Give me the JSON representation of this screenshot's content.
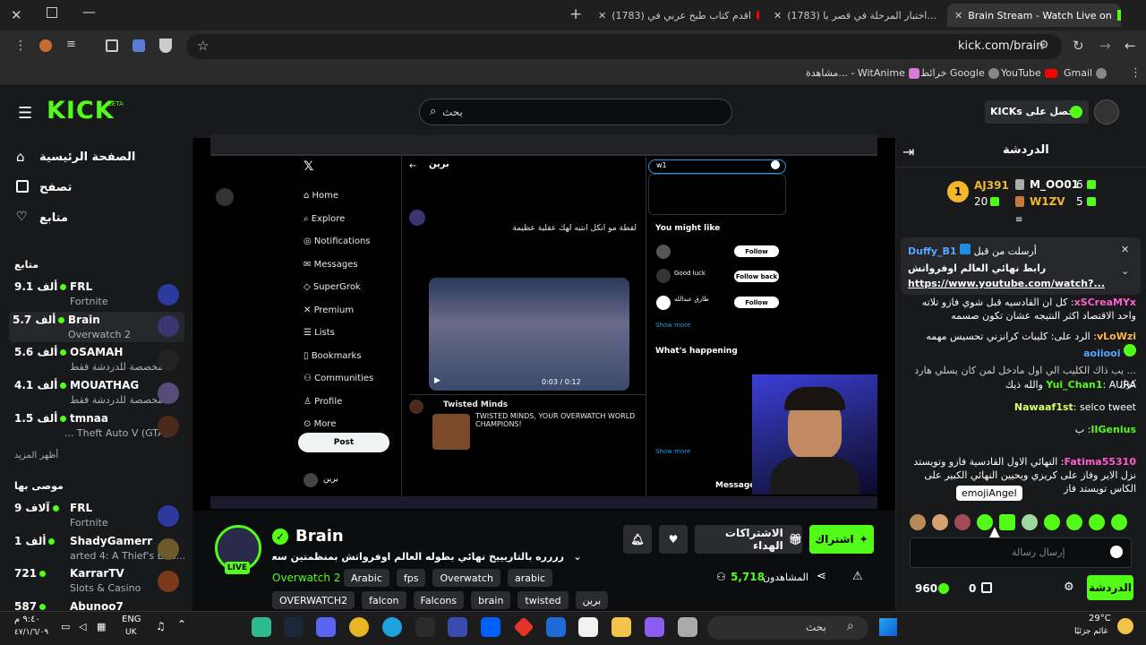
{
  "browser": {
    "tabs": [
      {
        "label": "Brain Stream - Watch Live on"
      },
      {
        "label": "(1783) اختبار المرحلة في قصر يا..."
      },
      {
        "label": "(1783) اقدم كتاب طبخ عربي في"
      }
    ],
    "url": "kick.com/brain",
    "bookmarks": [
      "Gmail",
      "YouTube",
      "خرائط Google",
      "مشاهدة... - WitAnime"
    ]
  },
  "header": {
    "logo": "KICK",
    "logo_badge": "BETA",
    "search_placeholder": "بحث",
    "get_kicks": "احصل على KICKs"
  },
  "sidebar": {
    "nav": [
      {
        "label": "الصفحة الرئيسية",
        "icon": "home-icon"
      },
      {
        "label": "تصفح",
        "icon": "browse-icon"
      },
      {
        "label": "متابع",
        "icon": "heart-icon"
      }
    ],
    "following_title": "متابع",
    "following": [
      {
        "name": "FRL",
        "viewers": "9.1 ألف",
        "category": "Fortnite"
      },
      {
        "name": "Brain",
        "viewers": "5.7 ألف",
        "category": "Overwatch 2"
      },
      {
        "name": "OSAMAH",
        "viewers": "5.6 ألف",
        "category": "مخصصة للدردشة فقط"
      },
      {
        "name": "MOUATHAG",
        "viewers": "4.1 ألف",
        "category": "مخصصة للدردشة فقط"
      },
      {
        "name": "tmnaa",
        "viewers": "1.5 ألف",
        "category": "Theft Auto V (GTA) ..."
      }
    ],
    "show_more": "أظهر المزيد",
    "recommended_title": "موصى بها",
    "recommended": [
      {
        "name": "FRL",
        "viewers": "9 آلاف",
        "category": "Fortnite"
      },
      {
        "name": "ShadyGamerr",
        "viewers": "1 ألف",
        "category": "arted 4: A Thief's End..."
      },
      {
        "name": "KarrarTV",
        "viewers": "721",
        "category": "Slots & Casino"
      },
      {
        "name": "Abunoo7",
        "viewers": "587",
        "category": ""
      }
    ]
  },
  "video": {
    "twitter": {
      "nav": [
        "Home",
        "Explore",
        "Notifications",
        "Messages",
        "SuperGrok",
        "Premium",
        "Lists",
        "Bookmarks",
        "Communities",
        "Profile",
        "More"
      ],
      "post_button": "Post",
      "profile_name": "برين",
      "tweet1": "لقطة مو انكل انتبه لهك عقلية عظيمة",
      "video_time": "0:03 / 0:12",
      "tweet2_name": "Twisted Minds",
      "tweet2_text": "TWISTED MINDS, YOUR OVERWATCH WORLD CHAMPIONS!",
      "search_value": "w1",
      "you_might_like": "You might like",
      "follow": "Follow",
      "follow_back": "Follow back",
      "suggest1": "Good luck",
      "suggest2": "طارق عبدالله",
      "show_more": "Show more",
      "whats_happening": "What's happening",
      "messages": "Messages"
    }
  },
  "stream": {
    "channel": "Brain",
    "live": "LIVE",
    "title": "رررره بالتاريييخ نهائي بطوله العالم اوفرواتش بمنظمتين سعودية , المحححححق...",
    "category": "Overwatch 2",
    "tags_row1": [
      "Arabic",
      "fps",
      "Overwatch",
      "arabic"
    ],
    "tags_row2": [
      "OVERWATCH2",
      "falcon",
      "Falcons",
      "brain",
      "twisted",
      "برين"
    ],
    "viewers": "5,718",
    "viewers_label": "المشاهدون",
    "subscribe": "اشتراك",
    "gift_subs": "الاشتراكات الهداء"
  },
  "chat": {
    "title": "الدردشة",
    "leaderboard": [
      {
        "name": "AJ391",
        "value": "20"
      },
      {
        "name": "M_OO01",
        "value": "6"
      },
      {
        "name": "W1ZV",
        "value": "5"
      }
    ],
    "pinned_by": "أرسلت من قبل",
    "pinned_user": "Duffy_B1",
    "pinned_text": "رابط نهائي العالم اوفرواتش",
    "pinned_link": "https://www.youtube.com/watch?...",
    "messages": [
      {
        "user": "xSCreaMYx",
        "text": "كل ان القادسيه قبل شوي فازو تلاته واحد الاقتصاد اكثر النتيجه عشان تكون صسمه"
      },
      {
        "user": "vLoWzi",
        "text": "الرد على: كليبات كرانزني تحسيس مهمه"
      },
      {
        "user": "aoiiooi",
        "text": ""
      },
      {
        "user": "",
        "text": "... يب ذاك الكليب الي اول مادخل لمن كان يسلي هارد كول"
      },
      {
        "user": "Yui_Chan1",
        "text": "AURA والله ذيك"
      },
      {
        "user": "Nawaaf1st",
        "text": "selco tweet"
      },
      {
        "user": "IIGenius",
        "text": "ب"
      },
      {
        "user": "Fatima55310",
        "text": "النهائي الاول القادسية فازو وتويستد نزل الاير وفاز على كريزي ويحيين النهائي الكبير على الكاس تويستد فاز"
      }
    ],
    "emote_tooltip": "emojiAngel",
    "input_placeholder": "إرسال رسالة",
    "points": "960",
    "subs": "0",
    "send": "الدردشة"
  },
  "taskbar": {
    "lang": "ENG",
    "region": "UK",
    "time": "٩:٤٠ م",
    "date": "٤٧/١/٦/٠٩",
    "temp": "29°C",
    "weather": "غائم جزئيًا",
    "search": "بحث"
  }
}
